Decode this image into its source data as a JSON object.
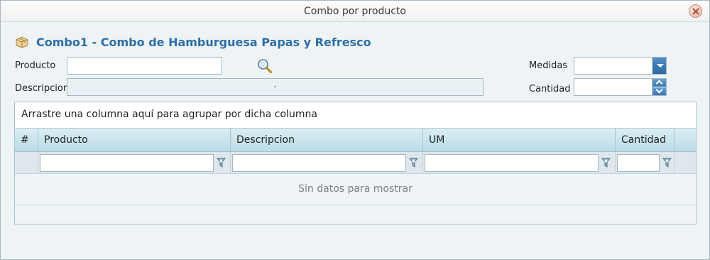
{
  "window": {
    "title": "Combo por producto"
  },
  "heading": "Combo1 - Combo de Hamburguesa Papas y Refresco",
  "form": {
    "producto_label": "Producto",
    "producto_value": "",
    "descripcion_label": "Descripcion",
    "descripcion_value": ".",
    "medidas_label": "Medidas",
    "medidas_value": "",
    "cantidad_label": "Cantidad",
    "cantidad_value": ""
  },
  "grid": {
    "group_panel_text": "Arrastre una columna aquí para agrupar por dicha columna",
    "columns": [
      "#",
      "Producto",
      "Descripcion",
      "UM",
      "Cantidad"
    ],
    "empty_text": "Sin datos para mostrar"
  },
  "icons": {
    "close": "close-icon",
    "heading": "box-icon",
    "search": "search-icon",
    "filter": "filter-icon"
  },
  "colors": {
    "heading": "#2d6ea8",
    "header_gradient_top": "#dbeef4",
    "header_gradient_bottom": "#b9dce7",
    "button_blue": "#3a76ad"
  }
}
